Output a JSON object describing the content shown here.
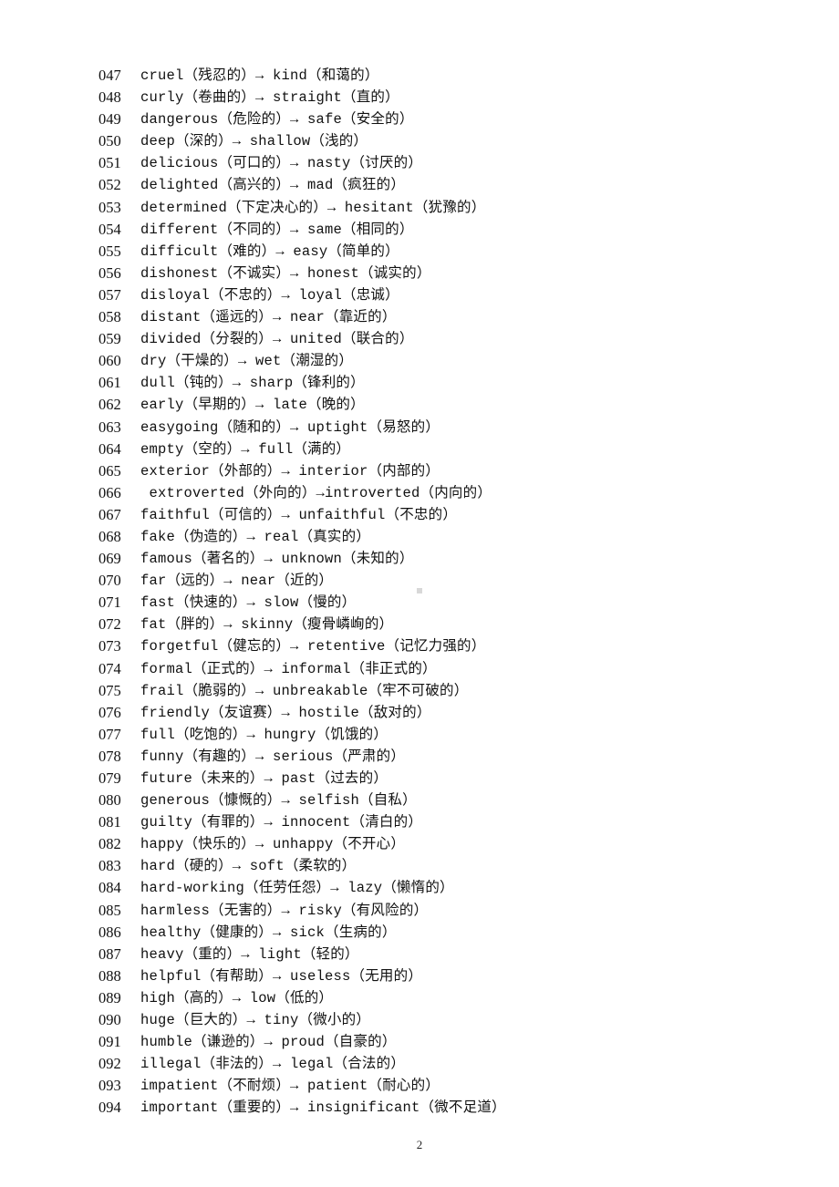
{
  "entries": [
    {
      "num": "047",
      "text": "cruel（残忍的）→ kind（和蔼的）"
    },
    {
      "num": "048",
      "text": "curly（卷曲的）→ straight（直的）"
    },
    {
      "num": "049",
      "text": "dangerous（危险的）→ safe（安全的）"
    },
    {
      "num": "050",
      "text": "deep（深的）→ shallow（浅的）"
    },
    {
      "num": "051",
      "text": "delicious（可口的）→ nasty（讨厌的）"
    },
    {
      "num": "052",
      "text": "delighted（高兴的）→ mad（疯狂的）"
    },
    {
      "num": "053",
      "text": "determined（下定决心的）→ hesitant（犹豫的）"
    },
    {
      "num": "054",
      "text": "different（不同的）→ same（相同的）"
    },
    {
      "num": "055",
      "text": "difficult（难的）→ easy（简单的）"
    },
    {
      "num": "056",
      "text": "dishonest（不诚实）→ honest（诚实的）"
    },
    {
      "num": "057",
      "text": "disloyal（不忠的）→ loyal（忠诚）"
    },
    {
      "num": "058",
      "text": "distant（遥远的）→ near（靠近的）"
    },
    {
      "num": "059",
      "text": "divided（分裂的）→ united（联合的）"
    },
    {
      "num": "060",
      "text": "dry（干燥的）→ wet（潮湿的）"
    },
    {
      "num": "061",
      "text": "dull（钝的）→ sharp（锋利的）"
    },
    {
      "num": "062",
      "text": "early（早期的）→ late（晚的）"
    },
    {
      "num": "063",
      "text": "easygoing（随和的）→ uptight（易怒的）"
    },
    {
      "num": "064",
      "text": "empty（空的）→ full（满的）"
    },
    {
      "num": "065",
      "text": "exterior（外部的）→ interior（内部的）"
    },
    {
      "num": "066",
      "text": " extroverted（外向的）→introverted（内向的）"
    },
    {
      "num": "067",
      "text": "faithful（可信的）→ unfaithful（不忠的）"
    },
    {
      "num": "068",
      "text": "fake（伪造的）→ real（真实的）"
    },
    {
      "num": "069",
      "text": "famous（著名的）→ unknown（未知的）"
    },
    {
      "num": "070",
      "text": "far（远的）→ near（近的）"
    },
    {
      "num": "071",
      "text": "fast（快速的）→ slow（慢的）"
    },
    {
      "num": "072",
      "text": "fat（胖的）→ skinny（瘦骨嶙峋的）"
    },
    {
      "num": "073",
      "text": "forgetful（健忘的）→ retentive（记忆力强的）"
    },
    {
      "num": "074",
      "text": "formal（正式的）→ informal（非正式的）"
    },
    {
      "num": "075",
      "text": "frail（脆弱的）→ unbreakable（牢不可破的）"
    },
    {
      "num": "076",
      "text": "friendly（友谊赛）→ hostile（敌对的）"
    },
    {
      "num": "077",
      "text": "full（吃饱的）→ hungry（饥饿的）"
    },
    {
      "num": "078",
      "text": "funny（有趣的）→ serious（严肃的）"
    },
    {
      "num": "079",
      "text": "future（未来的）→ past（过去的）"
    },
    {
      "num": "080",
      "text": "generous（慷慨的）→ selfish（自私）"
    },
    {
      "num": "081",
      "text": "guilty（有罪的）→ innocent（清白的）"
    },
    {
      "num": "082",
      "text": "happy（快乐的）→ unhappy（不开心）"
    },
    {
      "num": "083",
      "text": "hard（硬的）→ soft（柔软的）"
    },
    {
      "num": "084",
      "text": "hard-working（任劳任怨）→ lazy（懒惰的）"
    },
    {
      "num": "085",
      "text": "harmless（无害的）→ risky（有风险的）"
    },
    {
      "num": "086",
      "text": "healthy（健康的）→ sick（生病的）"
    },
    {
      "num": "087",
      "text": "heavy（重的）→ light（轻的）"
    },
    {
      "num": "088",
      "text": "helpful（有帮助）→ useless（无用的）"
    },
    {
      "num": "089",
      "text": "high（高的）→ low（低的）"
    },
    {
      "num": "090",
      "text": "huge（巨大的）→ tiny（微小的）"
    },
    {
      "num": "091",
      "text": "humble（谦逊的）→ proud（自豪的）"
    },
    {
      "num": "092",
      "text": "illegal（非法的）→ legal（合法的）"
    },
    {
      "num": "093",
      "text": "impatient（不耐烦）→ patient（耐心的）"
    },
    {
      "num": "094",
      "text": "important（重要的）→ insignificant（微不足道）"
    }
  ],
  "footer": {
    "page_number": "2"
  }
}
